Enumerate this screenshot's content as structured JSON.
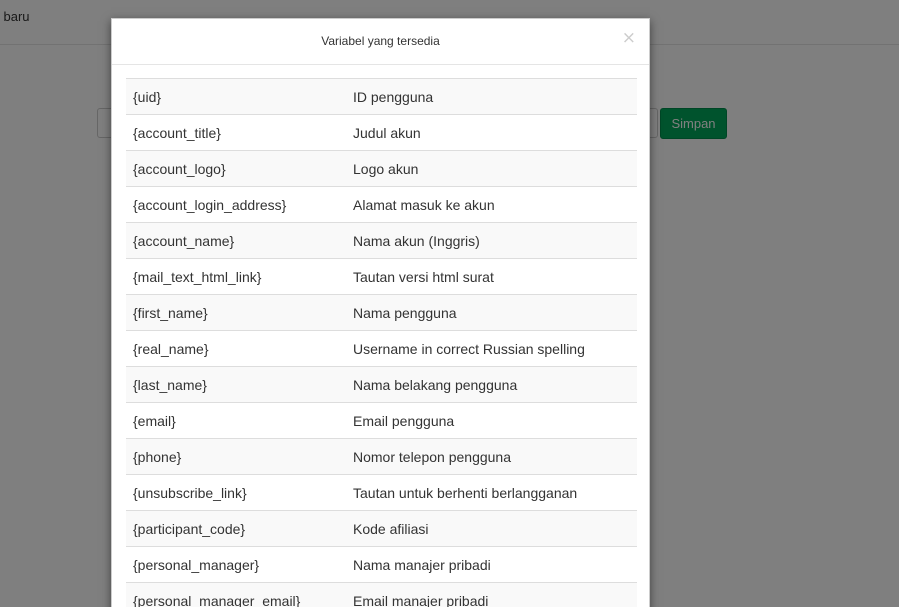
{
  "background": {
    "header_text": "i baru",
    "save_label": "Simpan",
    "accent_color": "#00a65a"
  },
  "modal": {
    "title": "Variabel yang tersedia",
    "close_label": "×",
    "rows": [
      {
        "variable": "{uid}",
        "description": "ID pengguna"
      },
      {
        "variable": "{account_title}",
        "description": "Judul akun"
      },
      {
        "variable": "{account_logo}",
        "description": "Logo akun"
      },
      {
        "variable": "{account_login_address}",
        "description": "Alamat masuk ke akun"
      },
      {
        "variable": "{account_name}",
        "description": "Nama akun (Inggris)"
      },
      {
        "variable": "{mail_text_html_link}",
        "description": "Tautan versi html surat"
      },
      {
        "variable": "{first_name}",
        "description": "Nama pengguna"
      },
      {
        "variable": "{real_name}",
        "description": "Username in correct Russian spelling"
      },
      {
        "variable": "{last_name}",
        "description": "Nama belakang pengguna"
      },
      {
        "variable": "{email}",
        "description": "Email pengguna"
      },
      {
        "variable": "{phone}",
        "description": "Nomor telepon pengguna"
      },
      {
        "variable": "{unsubscribe_link}",
        "description": "Tautan untuk berhenti berlangganan"
      },
      {
        "variable": "{participant_code}",
        "description": "Kode afiliasi"
      },
      {
        "variable": "{personal_manager}",
        "description": "Nama manajer pribadi"
      },
      {
        "variable": "{personal_manager_email}",
        "description": "Email manajer pribadi"
      }
    ]
  }
}
